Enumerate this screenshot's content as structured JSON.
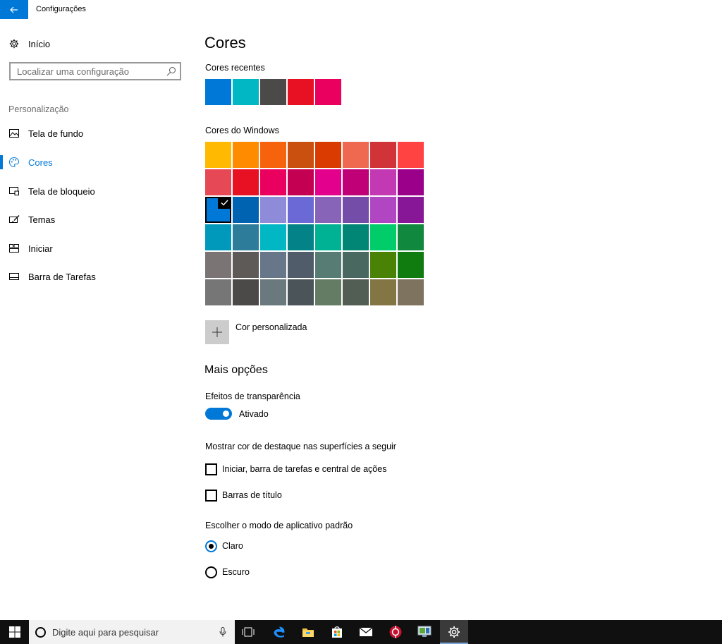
{
  "window": {
    "title": "Configurações"
  },
  "sidebar": {
    "home_label": "Início",
    "search_placeholder": "Localizar uma configuração",
    "section": "Personalização",
    "items": [
      {
        "label": "Tela de fundo",
        "icon": "picture-icon",
        "active": false
      },
      {
        "label": "Cores",
        "icon": "palette-icon",
        "active": true
      },
      {
        "label": "Tela de bloqueio",
        "icon": "lock-screen-icon",
        "active": false
      },
      {
        "label": "Temas",
        "icon": "brush-icon",
        "active": false
      },
      {
        "label": "Iniciar",
        "icon": "start-tiles-icon",
        "active": false
      },
      {
        "label": "Barra de Tarefas",
        "icon": "taskbar-icon",
        "active": false
      }
    ]
  },
  "main": {
    "title": "Cores",
    "recent_label": "Cores recentes",
    "recent_colors": [
      "#0078d7",
      "#00b7c3",
      "#4c4a48",
      "#e81123",
      "#ea005e"
    ],
    "windows_label": "Cores do Windows",
    "windows_colors": [
      [
        "#ffb900",
        "#ff8c00",
        "#f7630c",
        "#ca5010",
        "#da3b01",
        "#ef6950",
        "#d13438",
        "#ff4343"
      ],
      [
        "#e74856",
        "#e81123",
        "#ea005e",
        "#c30052",
        "#e3008c",
        "#bf0077",
        "#c239b3",
        "#9a0089"
      ],
      [
        "#0078d7",
        "#0063b1",
        "#8e8cd8",
        "#6b69d6",
        "#8764b8",
        "#744da9",
        "#b146c2",
        "#881798"
      ],
      [
        "#0099bc",
        "#2d7d9a",
        "#00b7c3",
        "#038387",
        "#00b294",
        "#018574",
        "#00cc6a",
        "#10893e"
      ],
      [
        "#7a7574",
        "#5d5a58",
        "#68768a",
        "#515c6b",
        "#567c73",
        "#486860",
        "#498205",
        "#107c10"
      ],
      [
        "#767676",
        "#4c4a48",
        "#69797e",
        "#4a5459",
        "#647c64",
        "#525e54",
        "#847545",
        "#7e735f"
      ]
    ],
    "selected_color": "#0078d7",
    "custom_color_label": "Cor personalizada",
    "more_options_heading": "Mais opções",
    "transparency_label": "Efeitos de transparência",
    "transparency_state": "Ativado",
    "accent_surfaces_label": "Mostrar cor de destaque nas superfícies a seguir",
    "checkbox_start": "Iniciar, barra de tarefas e central de ações",
    "checkbox_titlebars": "Barras de título",
    "app_mode_label": "Escolher o modo de aplicativo padrão",
    "radio_light": "Claro",
    "radio_dark": "Escuro",
    "app_mode_selected": "Claro"
  },
  "taskbar": {
    "search_placeholder": "Digite aqui para pesquisar",
    "pinned": [
      "task-view-icon",
      "edge-icon",
      "file-explorer-icon",
      "store-icon",
      "mail-icon",
      "app-red-icon",
      "app-monitor-icon",
      "settings-icon"
    ],
    "active": "settings-icon"
  },
  "colors": {
    "accent": "#0078d7",
    "taskbar": "#101010"
  }
}
